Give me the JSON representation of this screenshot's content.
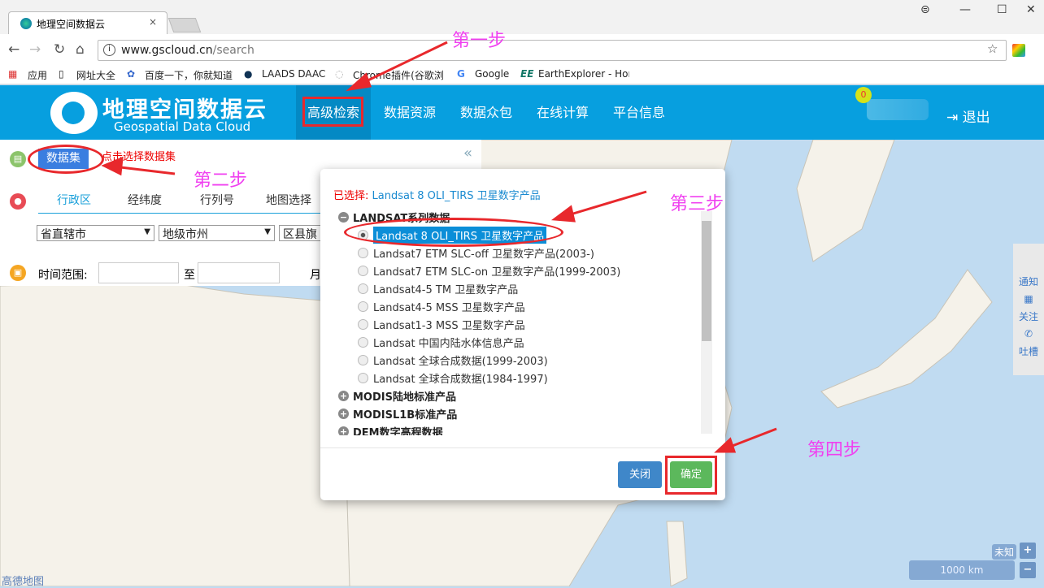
{
  "browser": {
    "tab_title": "地理空间数据云",
    "url_host": "www.gscloud.cn",
    "url_path": "/search",
    "bookmarks": [
      "应用",
      "网址大全",
      "百度一下，你就知道",
      "LAADS DAAC",
      "Chrome插件(谷歌浏览",
      "Google",
      "EarthExplorer - Hon"
    ]
  },
  "header": {
    "logo_title": "地理空间数据云",
    "logo_subtitle": "Geospatial Data Cloud",
    "menu": [
      "高级检索",
      "数据资源",
      "数据众包",
      "在线计算",
      "平台信息"
    ],
    "badge": "0",
    "logout": "退出"
  },
  "panel": {
    "dataset_button": "数据集",
    "dataset_hint": "点击选择数据集",
    "tabs": [
      "行政区",
      "经纬度",
      "行列号",
      "地图选择"
    ],
    "selects": [
      "省直辖市",
      "地级市州",
      "区县旗"
    ],
    "time_label": "时间范围:",
    "to_label": "至",
    "month_label": "月"
  },
  "modal": {
    "selected_label": "已选择:",
    "selected_value": "Landsat 8 OLI_TIRS 卫星数字产品",
    "group_open": "LANDSAT系列数据",
    "items": [
      "Landsat 8 OLI_TIRS 卫星数字产品",
      "Landsat7 ETM SLC-off 卫星数字产品(2003-)",
      "Landsat7 ETM SLC-on 卫星数字产品(1999-2003)",
      "Landsat4-5 TM 卫星数字产品",
      "Landsat4-5 MSS 卫星数字产品",
      "Landsat1-3 MSS 卫星数字产品",
      "Landsat 中国内陆水体信息产品",
      "Landsat 全球合成数据(1999-2003)",
      "Landsat 全球合成数据(1984-1997)"
    ],
    "selected_index": 0,
    "groups_closed": [
      "MODIS陆地标准产品",
      "MODISL1B标准产品",
      "DEM数字高程数据"
    ],
    "close": "关闭",
    "confirm": "确定"
  },
  "annotations": {
    "step1": "第一步",
    "step2": "第二步",
    "step3": "第三步",
    "step4": "第四步"
  },
  "side": {
    "notify": "通知",
    "follow": "关注",
    "feedback": "吐槽"
  },
  "map": {
    "scale": "1000 km",
    "unknown": "未知",
    "zoom_in": "+",
    "zoom_out": "−",
    "attribution": "高德地图"
  },
  "colors": {
    "header": "#079fdf",
    "accent": "#0b8ed8",
    "confirm": "#5cb85c",
    "close": "#3f87c9",
    "annotation": "#f040f0",
    "highlight": "#e8282c"
  }
}
